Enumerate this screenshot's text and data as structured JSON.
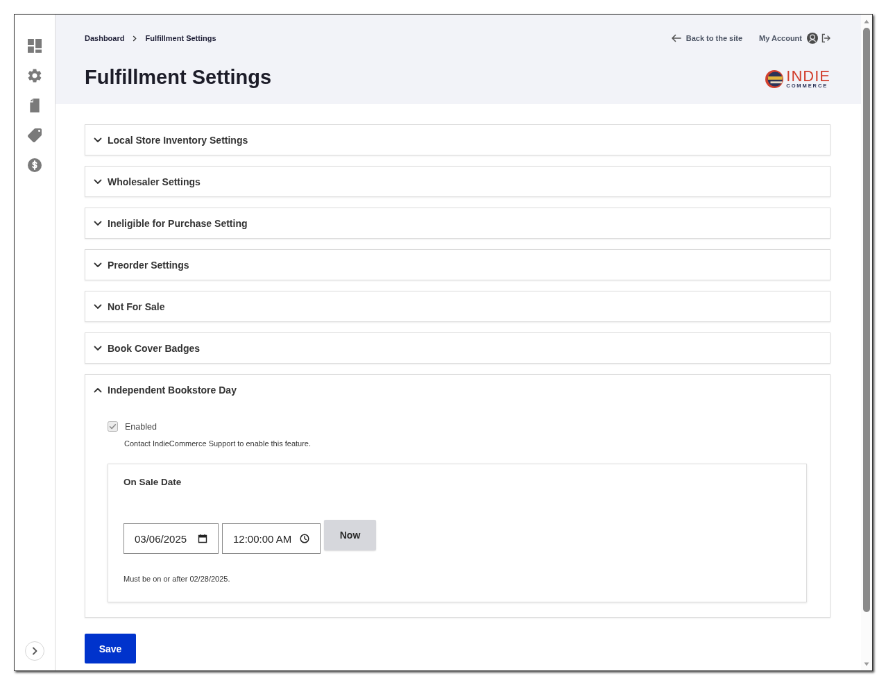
{
  "breadcrumbs": [
    {
      "label": "Dashboard"
    },
    {
      "label": "Fulfillment Settings"
    }
  ],
  "header_links": [
    {
      "kind": "back",
      "label": "Back to the site"
    },
    {
      "kind": "account",
      "label": "My Account"
    }
  ],
  "title": "Fulfillment Settings",
  "logo": {
    "wordmark": "INDIE",
    "tagline": "COMMERCE"
  },
  "sections": [
    {
      "title": "Local Store Inventory Settings",
      "expanded": false
    },
    {
      "title": "Wholesaler Settings",
      "expanded": false
    },
    {
      "title": "Ineligible for Purchase Setting",
      "expanded": false
    },
    {
      "title": "Preorder Settings",
      "expanded": false
    },
    {
      "title": "Not For Sale",
      "expanded": false
    },
    {
      "title": "Book Cover Badges",
      "expanded": false
    },
    {
      "title": "Independent Bookstore Day",
      "expanded": true,
      "checkbox": {
        "label": "Enabled",
        "checked": true,
        "disabled": true
      },
      "help": "Contact IndieCommerce Support to enable this feature.",
      "fieldset": {
        "legend": "On Sale Date",
        "date": "03/06/2025",
        "time": "12:00:00 AM",
        "button": "Now",
        "hint": "Must be on or after 02/28/2025."
      }
    }
  ],
  "save_button": "Save"
}
